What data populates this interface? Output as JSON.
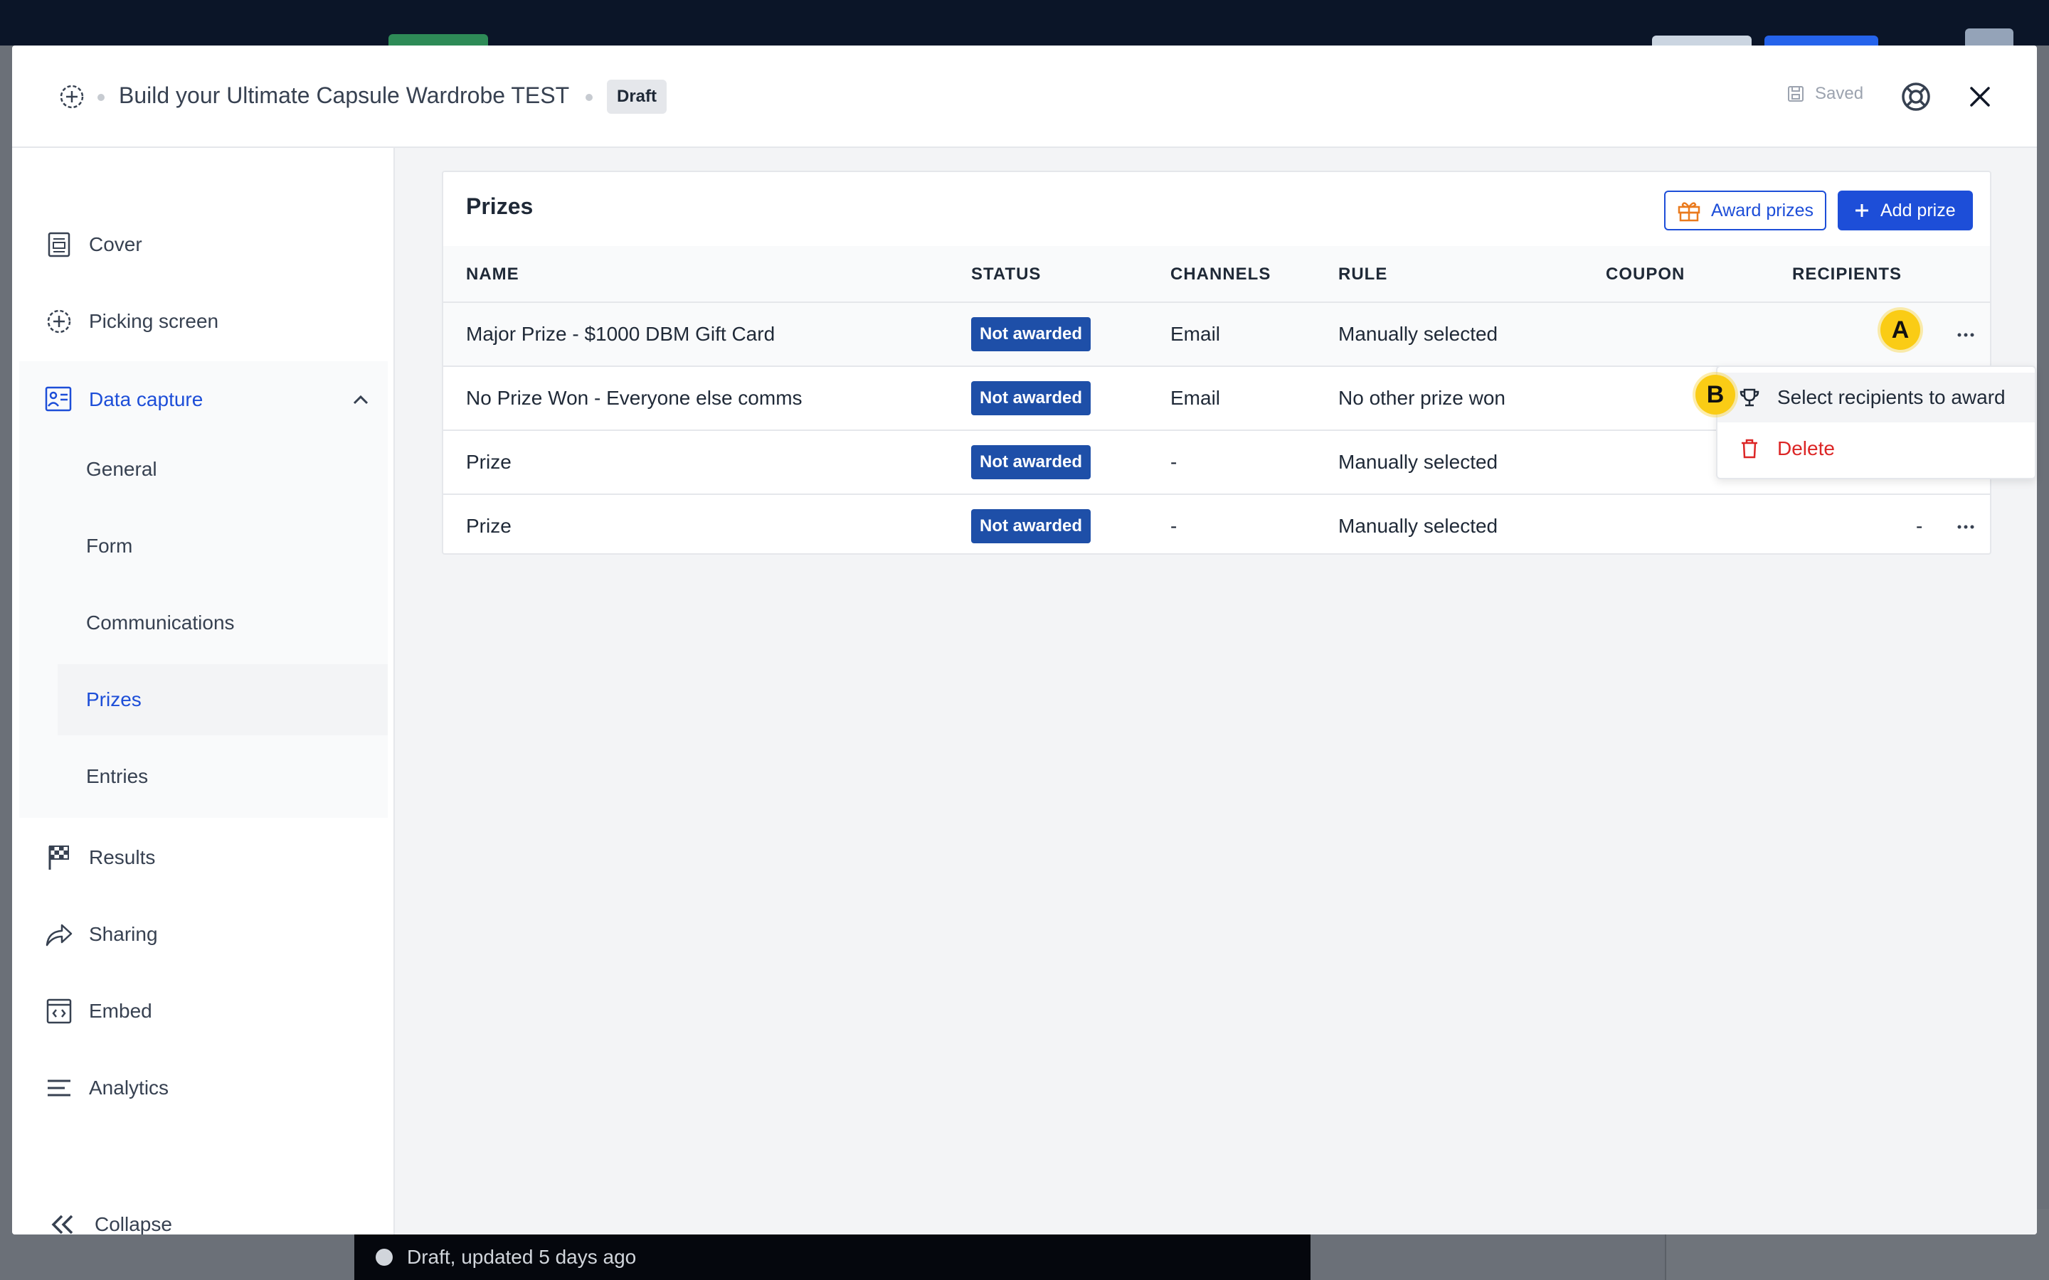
{
  "background": {
    "status_text": "Draft, updated 5 days ago"
  },
  "header": {
    "title": "Build your Ultimate Capsule Wardrobe TEST",
    "badge": "Draft",
    "saved_label": "Saved"
  },
  "sidebar": {
    "items": [
      {
        "label": "Cover",
        "icon": "document-icon"
      },
      {
        "label": "Picking screen",
        "icon": "crosshair-icon"
      },
      {
        "label": "Data capture",
        "icon": "data-capture-icon"
      },
      {
        "label": "Results",
        "icon": "checkered-flag-icon"
      },
      {
        "label": "Sharing",
        "icon": "share-icon"
      },
      {
        "label": "Embed",
        "icon": "embed-icon"
      },
      {
        "label": "Analytics",
        "icon": "analytics-icon"
      }
    ],
    "subitems": [
      {
        "label": "General"
      },
      {
        "label": "Form"
      },
      {
        "label": "Communications"
      },
      {
        "label": "Prizes"
      },
      {
        "label": "Entries"
      }
    ],
    "collapse_label": "Collapse"
  },
  "prizes": {
    "title": "Prizes",
    "award_button": "Award prizes",
    "add_button": "Add prize",
    "columns": [
      "NAME",
      "STATUS",
      "CHANNELS",
      "RULE",
      "COUPON",
      "RECIPIENTS"
    ],
    "rows": [
      {
        "name": "Major Prize - $1000 DBM Gift Card",
        "status": "Not awarded",
        "channels": "Email",
        "rule": "Manually selected",
        "coupon": "",
        "recipients": ""
      },
      {
        "name": "No Prize Won - Everyone else comms",
        "status": "Not awarded",
        "channels": "Email",
        "rule": "No other prize won",
        "coupon": "",
        "recipients": ""
      },
      {
        "name": "Prize",
        "status": "Not awarded",
        "channels": "-",
        "rule": "Manually selected",
        "coupon": "",
        "recipients": ""
      },
      {
        "name": "Prize",
        "status": "Not awarded",
        "channels": "-",
        "rule": "Manually selected",
        "coupon": "",
        "recipients": "-"
      }
    ]
  },
  "menu": {
    "items": [
      {
        "label": "Select recipients to award",
        "icon": "trophy-icon"
      },
      {
        "label": "Delete",
        "icon": "trash-icon"
      }
    ]
  },
  "markers": {
    "a": "A",
    "b": "B"
  },
  "colors": {
    "accent": "#1d4ed8",
    "badge": "#1e4fa8",
    "danger": "#dc2626",
    "marker": "#facc15"
  }
}
